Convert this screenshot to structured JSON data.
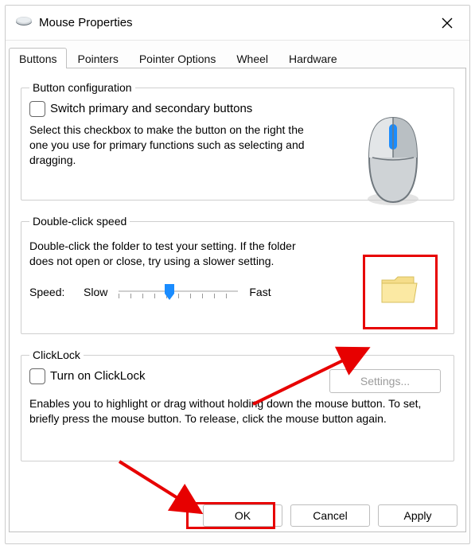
{
  "window": {
    "title": "Mouse Properties"
  },
  "tabs": [
    "Buttons",
    "Pointers",
    "Pointer Options",
    "Wheel",
    "Hardware"
  ],
  "active_tab": 0,
  "button_config": {
    "legend": "Button configuration",
    "checkbox_label": "Switch primary and secondary buttons",
    "checked": false,
    "desc": "Select this checkbox to make the button on the right the one you use for primary functions such as selecting and dragging."
  },
  "double_click": {
    "legend": "Double-click speed",
    "desc": "Double-click the folder to test your setting. If the folder does not open or close, try using a slower setting.",
    "speed_label": "Speed:",
    "slow": "Slow",
    "fast": "Fast",
    "value": 0.42
  },
  "clicklock": {
    "legend": "ClickLock",
    "checkbox_label": "Turn on ClickLock",
    "checked": false,
    "settings_label": "Settings...",
    "settings_enabled": false,
    "desc": "Enables you to highlight or drag without holding down the mouse button. To set, briefly press the mouse button. To release, click the mouse button again."
  },
  "buttons": {
    "ok": "OK",
    "cancel": "Cancel",
    "apply": "Apply"
  },
  "highlights": {
    "folder": true,
    "ok": true,
    "arrow_folder": true,
    "arrow_ok": true
  },
  "colors": {
    "accent": "#1a8cff",
    "hl": "#e70000"
  }
}
